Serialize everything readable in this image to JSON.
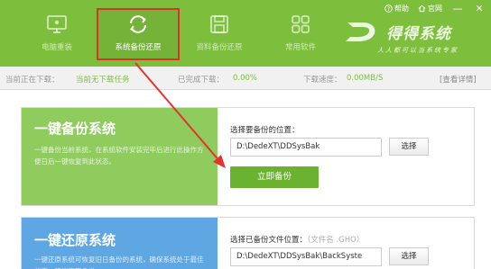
{
  "topbar": {
    "help_label": "帮助",
    "website_label": "官网",
    "minimize_label": "—",
    "close_label": "✕"
  },
  "nav": {
    "items": [
      {
        "label": "电脑重装",
        "icon": "monitor-icon"
      },
      {
        "label": "系统备份还原",
        "icon": "refresh-icon"
      },
      {
        "label": "资料备份还原",
        "icon": "save-icon"
      },
      {
        "label": "常用软件",
        "icon": "grid-icon"
      }
    ],
    "active_index": 1
  },
  "brand": {
    "name": "得得系统",
    "slogan": "人人都可以当系统专家"
  },
  "status": {
    "current_download_label": "当前正在下载：",
    "current_download_value": "当前无下载任务",
    "completed_label": "已完成下载：",
    "completed_value": "0.00%",
    "speed_label": "下载速度：",
    "speed_value": "0.00MB/S",
    "details_link": "[查看详情]"
  },
  "backup": {
    "title": "一键备份系统",
    "description": "一键备份当前系统，在系统软件安装完毕后进行此操作方便日后一键恢复到此状态。",
    "location_label": "选择要备份的位置：",
    "path_value": "D:\\DedeXT\\DDSysBak",
    "choose_label": "选择",
    "backup_button": "立即备份"
  },
  "restore": {
    "title": "一键还原系统",
    "description": "一键还原系统可恢复旧日备份的系统，确保系统处于最佳状态，建议定期备份。",
    "file_label": "选择已备份文件位置：",
    "file_hint": "（文件名 .GHO）",
    "path_value": "D:\\DedeXT\\DDSysBak\\BackSyste",
    "choose_label": "选择"
  },
  "colors": {
    "header_green": "#7dbf3c",
    "active_outline": "#d9342b",
    "backup_card": "#8fcb5d",
    "restore_card": "#5ea7e3",
    "button_green": "#6ab22f",
    "annotation_arrow": "#e2342c"
  }
}
